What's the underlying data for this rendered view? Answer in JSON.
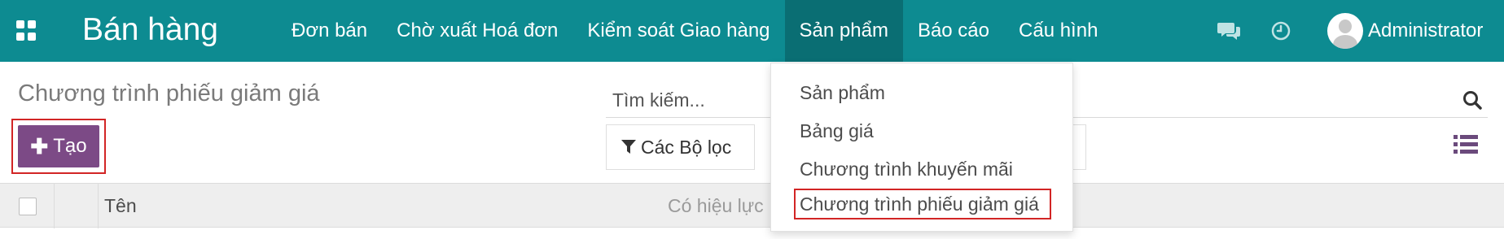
{
  "navbar": {
    "app_title": "Bán hàng",
    "menu": [
      {
        "label": "Đơn bán"
      },
      {
        "label": "Chờ xuất Hoá đơn"
      },
      {
        "label": "Kiểm soát Giao hàng"
      },
      {
        "label": "Sản phẩm",
        "active": true
      },
      {
        "label": "Báo cáo"
      },
      {
        "label": "Cấu hình"
      }
    ],
    "user_name": "Administrator"
  },
  "page": {
    "title": "Chương trình phiếu giảm giá",
    "create_label": "Tạo"
  },
  "search": {
    "placeholder": "Tìm kiếm...",
    "value": ""
  },
  "filters": {
    "label": "Các Bộ lọc"
  },
  "table": {
    "columns": [
      "Tên",
      "Có hiệu lực"
    ]
  },
  "dropdown": {
    "items": [
      {
        "label": "Sản phẩm"
      },
      {
        "label": "Bảng giá"
      },
      {
        "label": "Chương trình khuyến mãi"
      },
      {
        "label": "Chương trình phiếu giảm giá",
        "highlighted": true
      }
    ]
  },
  "colors": {
    "navbar": "#0d8b91",
    "navbar_active": "#0a6e73",
    "primary_button": "#7c4a86",
    "highlight_border": "#d22525"
  }
}
